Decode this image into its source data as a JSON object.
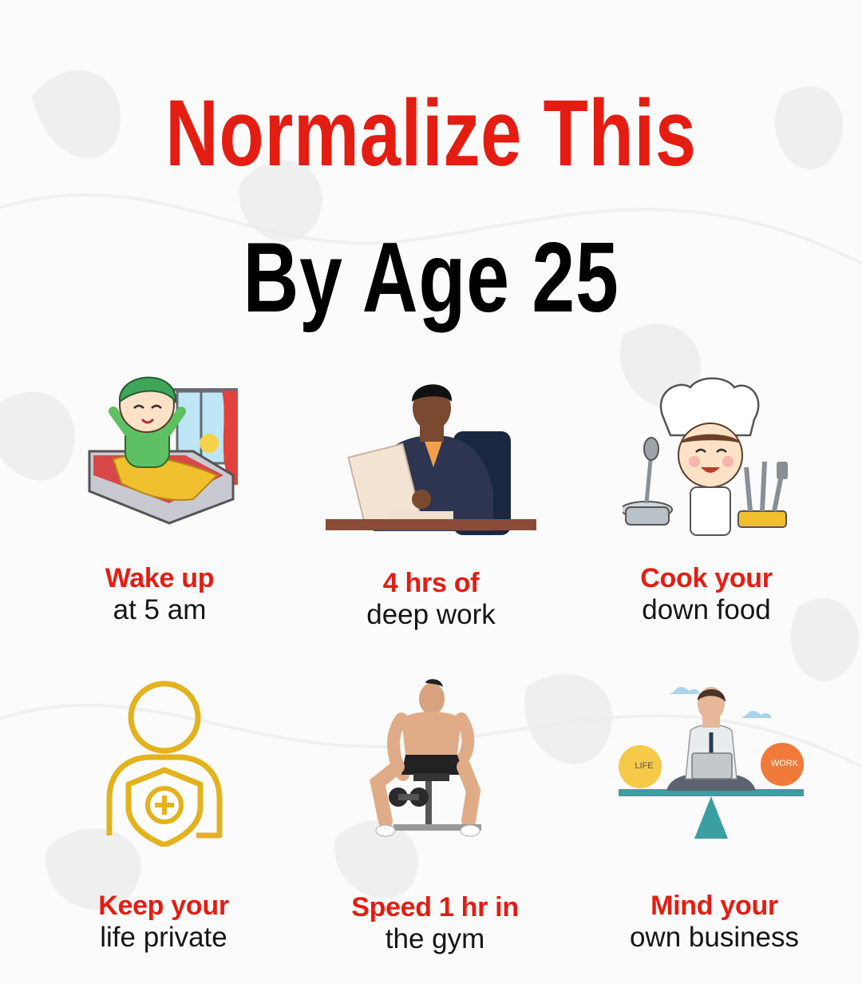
{
  "header": {
    "title_line1": "Normalize This",
    "title_line2": "By Age 25"
  },
  "colors": {
    "accent_red": "#e41d12",
    "text_black": "#000000",
    "icon_gold": "#e3b21c"
  },
  "items": [
    {
      "highlight": "Wake up",
      "text": "at 5 am",
      "icon": "waking-boy-in-bed-icon"
    },
    {
      "highlight": "4 hrs of",
      "text": "deep work",
      "icon": "man-at-desk-working-icon"
    },
    {
      "highlight": "Cook your",
      "text": "down food",
      "icon": "chef-cooking-icon"
    },
    {
      "highlight": "Keep your",
      "text": "life private",
      "icon": "person-shield-privacy-icon"
    },
    {
      "highlight": "Speed 1 hr in",
      "text": "the gym",
      "icon": "gym-man-dumbbell-icon"
    },
    {
      "highlight": "Mind your",
      "text": "own business",
      "icon": "life-work-balance-icon"
    }
  ],
  "balance_labels": {
    "left": "LIFE",
    "right": "WORK"
  }
}
